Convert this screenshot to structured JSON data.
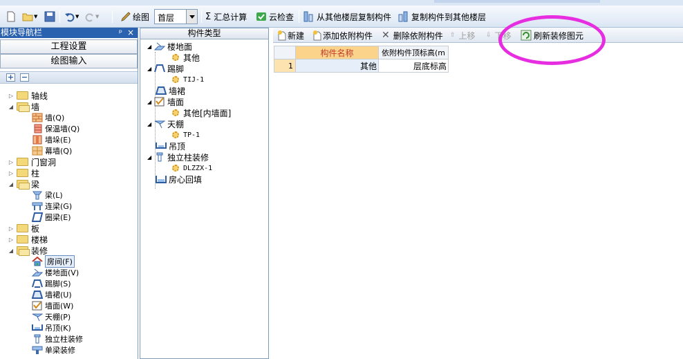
{
  "toolbar": {
    "draw_label": "绘图",
    "floor_value": "首层",
    "sum_label": "汇总计算",
    "cloud_check_label": "云检查",
    "copy_from_label": "从其他楼层复制构件",
    "copy_to_label": "复制构件到其他楼层"
  },
  "nav": {
    "title": "模块导航栏",
    "pin": "ᵖ",
    "close": "×",
    "project_settings": "工程设置",
    "drawing_input": "绘图输入",
    "tree": [
      {
        "label": "轴线"
      },
      {
        "label": "墙"
      },
      {
        "label": "墙(Q)"
      },
      {
        "label": "保温墙(Q)"
      },
      {
        "label": "墙垛(E)"
      },
      {
        "label": "幕墙(Q)"
      },
      {
        "label": "门窗洞"
      },
      {
        "label": "柱"
      },
      {
        "label": "梁"
      },
      {
        "label": "梁(L)"
      },
      {
        "label": "连梁(G)"
      },
      {
        "label": "圈梁(E)"
      },
      {
        "label": "板"
      },
      {
        "label": "楼梯"
      },
      {
        "label": "装修"
      },
      {
        "label": "房间(F)"
      },
      {
        "label": "楼地面(V)"
      },
      {
        "label": "踢脚(S)"
      },
      {
        "label": "墙裙(U)"
      },
      {
        "label": "墙面(W)"
      },
      {
        "label": "天棚(P)"
      },
      {
        "label": "吊顶(K)"
      },
      {
        "label": "独立柱装修"
      },
      {
        "label": "单梁装修"
      }
    ]
  },
  "component_type": {
    "header": "构件类型",
    "items": [
      {
        "label": "楼地面"
      },
      {
        "label": "其他"
      },
      {
        "label": "踢脚"
      },
      {
        "label": "TIJ-1"
      },
      {
        "label": "墙裙"
      },
      {
        "label": "墙面"
      },
      {
        "label": "其他[内墙面]"
      },
      {
        "label": "天棚"
      },
      {
        "label": "TP-1"
      },
      {
        "label": "吊顶"
      },
      {
        "label": "独立柱装修"
      },
      {
        "label": "DLZZX-1"
      },
      {
        "label": "房心回填"
      }
    ]
  },
  "right_toolbar": {
    "new": "新建",
    "add_dep": "添加依附构件",
    "del_dep": "删除依附构件",
    "move_up": "上移",
    "move_down": "下移",
    "refresh": "刷新装修图元"
  },
  "grid": {
    "columns": [
      "构件名称",
      "依附构件顶标高(m"
    ],
    "rows": [
      {
        "num": "1",
        "name": "其他",
        "value": "层底标高"
      }
    ]
  },
  "colors": {
    "nav_title_bg": "#2b62b0",
    "highlight_circle": "#e62ee0",
    "header_highlight": "#fcd38b"
  }
}
